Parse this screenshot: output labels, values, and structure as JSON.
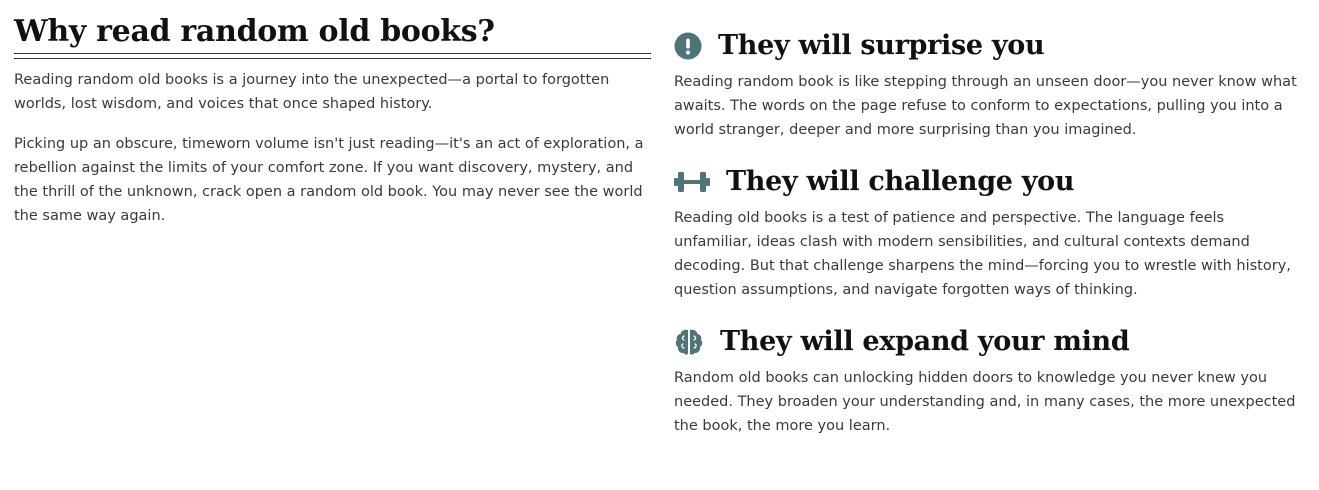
{
  "accent_color": "#4e7378",
  "intro": {
    "title": "Why read random old books?",
    "paragraphs": [
      "Reading random old books is a journey into the unexpected—a portal to forgotten worlds, lost wisdom, and voices that once shaped history.",
      "Picking up an obscure, timeworn volume isn't just reading—it's an act of exploration, a rebellion against the limits of your comfort zone. If you want discovery, mystery, and the thrill of the unknown, crack open a random old book. You may never see the world the same way again."
    ]
  },
  "reasons": [
    {
      "icon": "exclamation-circle-icon",
      "title": "They will surprise you",
      "text": "Reading random book is like stepping through an unseen door—you never know what awaits. The words on the page refuse to conform to expectations, pulling you into a world stranger, deeper and more surprising than you imagined."
    },
    {
      "icon": "dumbbell-icon",
      "title": "They will challenge you",
      "text": "Reading old books is a test of patience and perspective. The language feels unfamiliar, ideas clash with modern sensibilities, and cultural contexts demand decoding. But that challenge sharpens the mind—forcing you to wrestle with history, question assumptions, and navigate forgotten ways of thinking."
    },
    {
      "icon": "brain-icon",
      "title": "They will expand your mind",
      "text": "Random old books can unlocking hidden doors to knowledge you never knew you needed. They broaden your understanding and, in many cases, the more unexpected the book, the more you learn."
    }
  ]
}
